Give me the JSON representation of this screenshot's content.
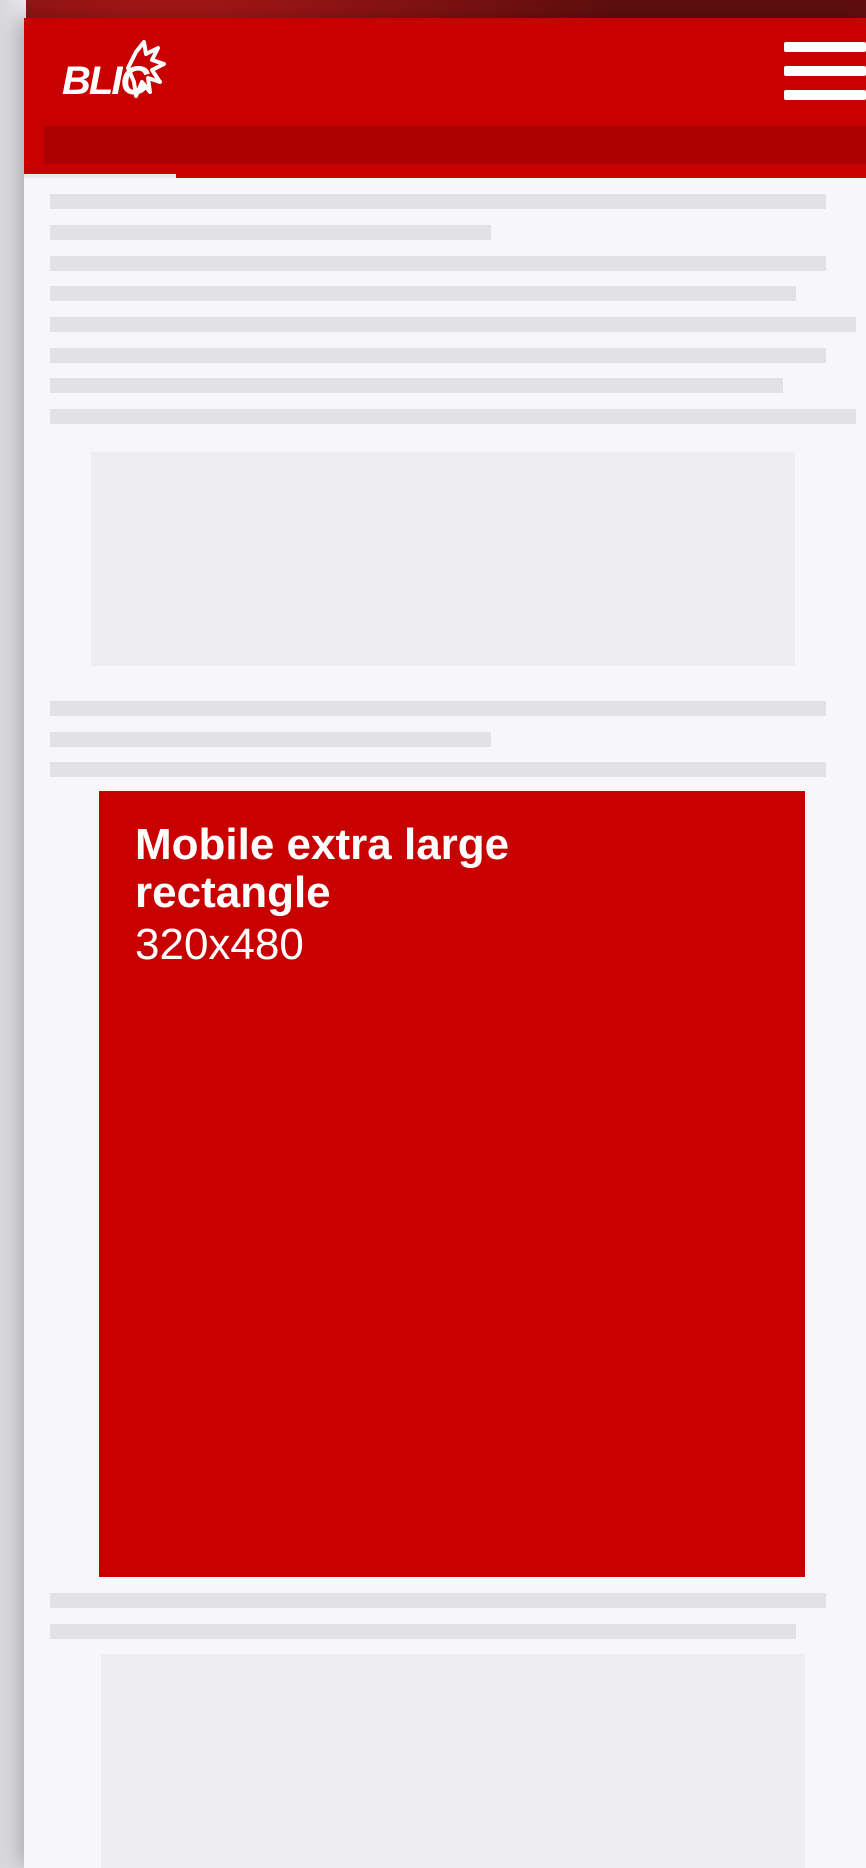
{
  "header": {
    "logo_text": "BLIC",
    "menu_icon": "hamburger-menu-icon",
    "brand_color": "#c80000",
    "subnav_color": "#ad0000",
    "scroll_progress_percent": 18
  },
  "advert": {
    "title": "Mobile extra large rectangle",
    "size": "320x480",
    "background": "#c80000"
  },
  "placeholder_colors": {
    "text_line": "#e1e1e6",
    "image": "#eeeef2"
  }
}
